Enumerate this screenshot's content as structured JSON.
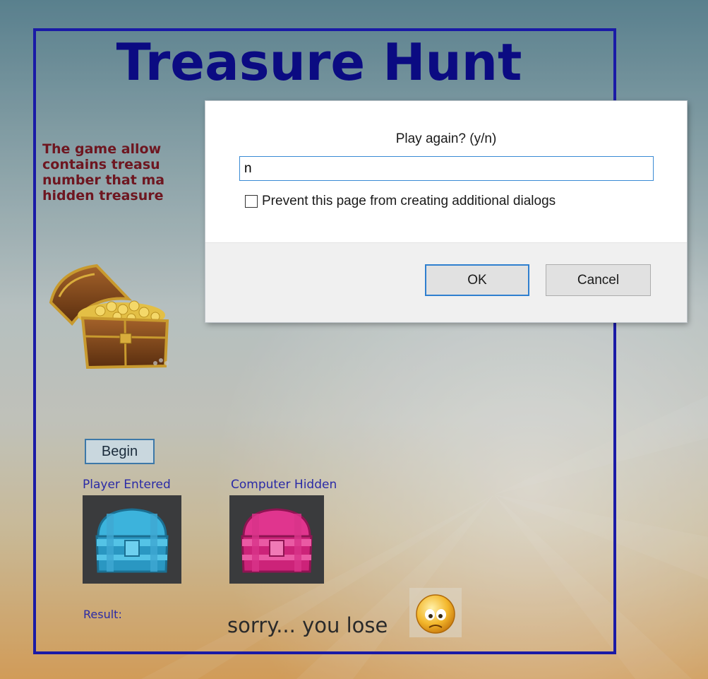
{
  "game": {
    "title": "Treasure Hunt",
    "intro_lines": [
      "The game allow",
      "contains treasu",
      "number that ma",
      "hidden treasure"
    ],
    "begin_label": "Begin",
    "player_label": "Player Entered",
    "computer_label": "Computer Hidden",
    "result_label": "Result:",
    "result_text": "sorry... you lose",
    "icons": {
      "chest": "treasure-chest-icon",
      "player_slot": "blue-chest-icon",
      "computer_slot": "pink-chest-icon",
      "result_face": "sad-face-icon"
    },
    "colors": {
      "title": "#0b0b82",
      "frame_border": "#1a1aa6",
      "intro_text": "#6e1620",
      "labels": "#2a2aa6",
      "player_chest": "#2c9cc7",
      "computer_chest": "#d3237f"
    }
  },
  "dialog": {
    "message": "Play again? (y/n)",
    "input_value": "n",
    "prevent_label": "Prevent this page from creating additional dialogs",
    "prevent_checked": false,
    "ok_label": "OK",
    "cancel_label": "Cancel"
  }
}
